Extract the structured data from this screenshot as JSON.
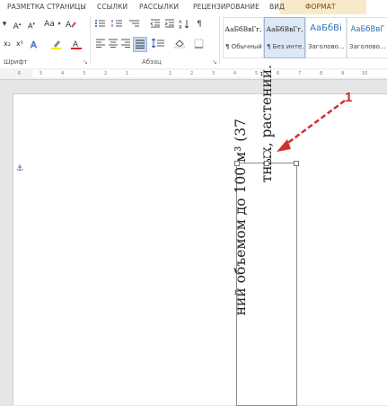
{
  "tabs": {
    "page_layout": "РАЗМЕТКА СТРАНИЦЫ",
    "references": "ССЫЛКИ",
    "mailings": "РАССЫЛКИ",
    "review": "РЕЦЕНЗИРОВАНИЕ",
    "view": "ВИД",
    "format": "ФОРМАТ"
  },
  "font_group": {
    "font_size_fragment": "▾",
    "grow": "A",
    "grow_sup": "▴",
    "shrink": "A",
    "shrink_sup": "▾",
    "change_case": "Aa",
    "subscript": "x₂",
    "superscript": "x²",
    "label": "Шрифт"
  },
  "paragraph_group": {
    "label": "Абзац"
  },
  "styles": [
    {
      "sample": "АаБбВвГг,",
      "name": "¶ Обычный"
    },
    {
      "sample": "АаБбВвГг,",
      "name": "¶ Без инте..."
    },
    {
      "sample": "АаБбВі",
      "name": "Заголово..."
    },
    {
      "sample": "АаБбВвГ",
      "name": "Заголово..."
    }
  ],
  "ruler": {
    "ticks": [
      "6",
      "5",
      "4",
      "3",
      "2",
      "1",
      "1",
      "2",
      "3",
      "4",
      "5",
      "6",
      "7",
      "8",
      "9",
      "10"
    ]
  },
  "textbox": {
    "line1": "ний объемом до 100 м³ (37",
    "line2": "тных, растений."
  },
  "callout": {
    "number": "1"
  },
  "colors": {
    "accent": "#2b579a",
    "format_tab_bg": "#f8e9c8",
    "callout": "#c62828"
  }
}
